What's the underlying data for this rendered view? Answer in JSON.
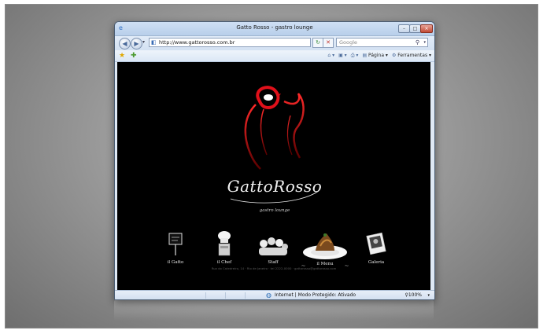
{
  "window": {
    "title": "Gatto Rosso - gastro lounge"
  },
  "address_bar": {
    "url": "http://www.gattorosso.com.br"
  },
  "search": {
    "placeholder": "Google"
  },
  "command_bar": {
    "page_label": "Página",
    "tools_label": "Ferramentas"
  },
  "site": {
    "brand": "GattoRosso",
    "tagline": "gastro lounge",
    "menu": [
      {
        "label": "il Gatto"
      },
      {
        "label": "il Chef"
      },
      {
        "label": "Staff"
      },
      {
        "label": "il Menu"
      },
      {
        "label": "Galeria"
      }
    ],
    "footer": "Rua do Catedreiro, 14 · Rio de Janeiro · tel 2222-0000 · gattorosso@gattorosso.com"
  },
  "status_bar": {
    "zone": "Internet | Modo Protegido: Ativado",
    "zoom": "100%"
  },
  "colors": {
    "accent_red": "#d0121a",
    "page_bg": "#000000",
    "chrome": "#dfe9f5"
  },
  "icons": [
    "ie-icon",
    "back-icon",
    "forward-icon",
    "refresh-icon",
    "stop-icon",
    "search-icon",
    "favorites-star-icon",
    "add-favorites-icon",
    "home-icon",
    "feeds-icon",
    "print-icon",
    "page-icon",
    "tools-icon",
    "globe-icon",
    "zoom-icon"
  ]
}
